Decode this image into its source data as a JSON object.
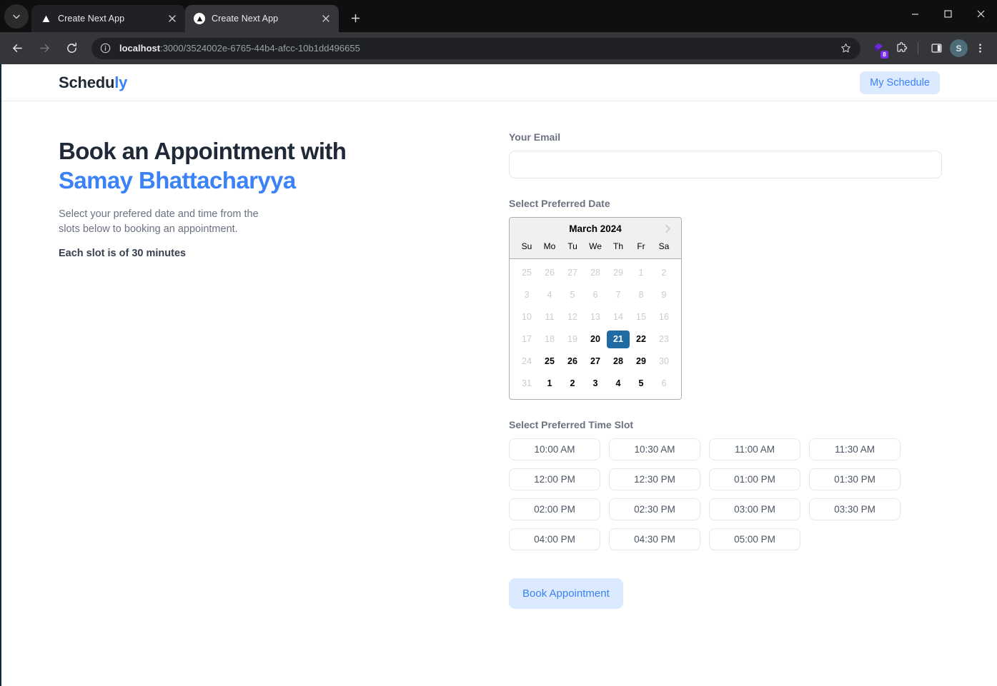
{
  "browser": {
    "tabs": [
      {
        "title": "Create Next App",
        "active": false
      },
      {
        "title": "Create Next App",
        "active": true
      }
    ],
    "new_tab_label": "+",
    "window": {
      "minimize": "—",
      "maximize": "☐",
      "close": "✕"
    },
    "toolbar": {
      "back": "back-arrow",
      "forward": "forward-arrow",
      "reload": "reload-icon",
      "url_host": "localhost",
      "url_rest": ":3000/3524002e-6765-44b4-afcc-10b1dd496655",
      "bookmark": "star-icon",
      "extension_badge": "8",
      "profile_initial": "S",
      "menu": "three-dot-icon"
    }
  },
  "header": {
    "logo_main": "Schedu",
    "logo_accent": "ly",
    "my_schedule_label": "My Schedule"
  },
  "hero": {
    "title_line1": "Book an Appointment with",
    "title_name": "Samay Bhattacharyya",
    "subtitle": "Select your prefered date and time from the slots below to booking an appointment.",
    "note": "Each slot is of 30 minutes"
  },
  "form": {
    "email_label": "Your Email",
    "email_value": "",
    "email_placeholder": "",
    "date_label": "Select Preferred Date",
    "time_label": "Select Preferred Time Slot",
    "submit_label": "Book Appointment"
  },
  "calendar": {
    "month_label": "March 2024",
    "next_icon": "chevron-right-icon",
    "day_names": [
      "Su",
      "Mo",
      "Tu",
      "We",
      "Th",
      "Fr",
      "Sa"
    ],
    "selected_day": 21,
    "selected_color": "#216ba5",
    "weeks": [
      [
        {
          "n": "25",
          "state": "disabled"
        },
        {
          "n": "26",
          "state": "disabled"
        },
        {
          "n": "27",
          "state": "disabled"
        },
        {
          "n": "28",
          "state": "disabled"
        },
        {
          "n": "29",
          "state": "disabled"
        },
        {
          "n": "1",
          "state": "disabled"
        },
        {
          "n": "2",
          "state": "disabled"
        }
      ],
      [
        {
          "n": "3",
          "state": "disabled"
        },
        {
          "n": "4",
          "state": "disabled"
        },
        {
          "n": "5",
          "state": "disabled"
        },
        {
          "n": "6",
          "state": "disabled"
        },
        {
          "n": "7",
          "state": "disabled"
        },
        {
          "n": "8",
          "state": "disabled"
        },
        {
          "n": "9",
          "state": "disabled"
        }
      ],
      [
        {
          "n": "10",
          "state": "disabled"
        },
        {
          "n": "11",
          "state": "disabled"
        },
        {
          "n": "12",
          "state": "disabled"
        },
        {
          "n": "13",
          "state": "disabled"
        },
        {
          "n": "14",
          "state": "disabled"
        },
        {
          "n": "15",
          "state": "disabled"
        },
        {
          "n": "16",
          "state": "disabled"
        }
      ],
      [
        {
          "n": "17",
          "state": "disabled"
        },
        {
          "n": "18",
          "state": "disabled"
        },
        {
          "n": "19",
          "state": "disabled"
        },
        {
          "n": "20",
          "state": "enabled"
        },
        {
          "n": "21",
          "state": "selected"
        },
        {
          "n": "22",
          "state": "enabled"
        },
        {
          "n": "23",
          "state": "disabled"
        }
      ],
      [
        {
          "n": "24",
          "state": "disabled"
        },
        {
          "n": "25",
          "state": "enabled"
        },
        {
          "n": "26",
          "state": "enabled"
        },
        {
          "n": "27",
          "state": "enabled"
        },
        {
          "n": "28",
          "state": "enabled"
        },
        {
          "n": "29",
          "state": "enabled"
        },
        {
          "n": "30",
          "state": "disabled"
        }
      ],
      [
        {
          "n": "31",
          "state": "disabled"
        },
        {
          "n": "1",
          "state": "enabled"
        },
        {
          "n": "2",
          "state": "enabled"
        },
        {
          "n": "3",
          "state": "enabled"
        },
        {
          "n": "4",
          "state": "enabled"
        },
        {
          "n": "5",
          "state": "enabled"
        },
        {
          "n": "6",
          "state": "disabled"
        }
      ]
    ]
  },
  "time_slots": [
    "10:00 AM",
    "10:30 AM",
    "11:00 AM",
    "11:30 AM",
    "12:00 PM",
    "12:30 PM",
    "01:00 PM",
    "01:30 PM",
    "02:00 PM",
    "02:30 PM",
    "03:00 PM",
    "03:30 PM",
    "04:00 PM",
    "04:30 PM",
    "05:00 PM"
  ]
}
